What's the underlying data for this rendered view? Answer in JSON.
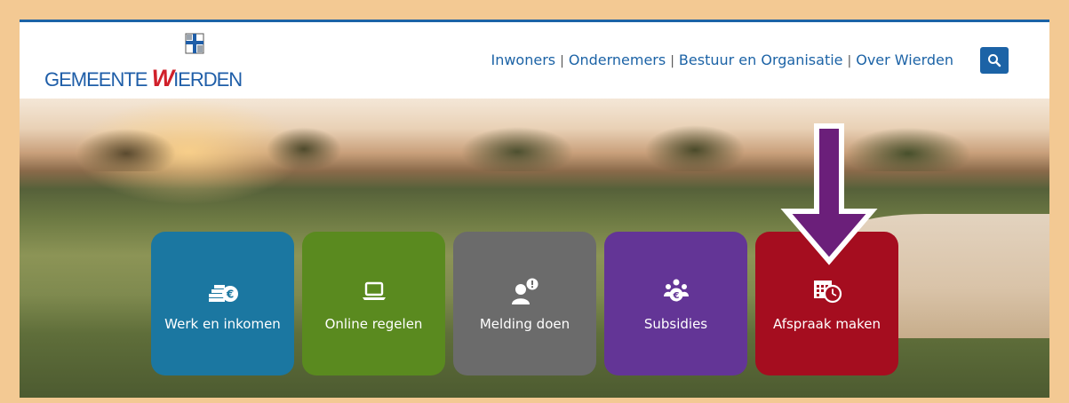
{
  "header": {
    "logo": {
      "word1": "GEMEENTE ",
      "w_letter": "W",
      "word2": "IERDEN"
    },
    "nav": [
      {
        "label": "Inwoners"
      },
      {
        "label": "Ondernemers"
      },
      {
        "label": "Bestuur en Organisatie"
      },
      {
        "label": "Over Wierden"
      }
    ],
    "search_icon": "search-icon"
  },
  "tiles": [
    {
      "label": "Werk en inkomen",
      "icon": "coins-euro-icon",
      "color": "#1b77a1"
    },
    {
      "label": "Online regelen",
      "icon": "laptop-icon",
      "color": "#5a8a1f"
    },
    {
      "label": "Melding doen",
      "icon": "person-alert-icon",
      "color": "#6b6b6b"
    },
    {
      "label": "Subsidies",
      "icon": "group-euro-icon",
      "color": "#633596"
    },
    {
      "label": "Afspraak maken",
      "icon": "calendar-clock-icon",
      "color": "#a50d1f"
    }
  ],
  "colors": {
    "outer_border": "#f3c993",
    "brand_blue": "#1c63a6",
    "arrow": "#6b1f7a"
  }
}
